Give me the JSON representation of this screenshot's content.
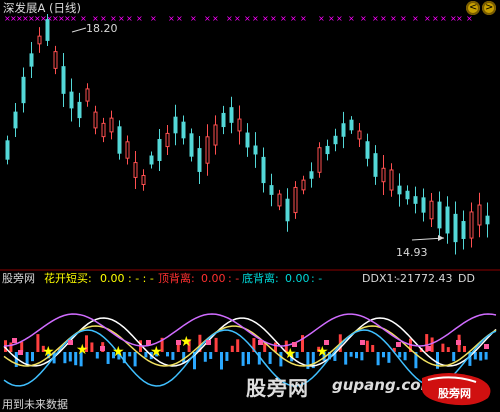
{
  "window": {
    "title": "深发展A (日线)",
    "nav_left": "<",
    "nav_right": ">"
  },
  "price_panel": {
    "high_label": "18.20",
    "low_label": "14.93"
  },
  "indicator_bar": {
    "name": "股旁网",
    "item1_label": "花开短买:",
    "item1_value": "0.00",
    "item1_extra": ": - : -",
    "item2_label": "顶背离:",
    "item2_value": "0.00",
    "item2_extra": ": -",
    "item3_label": "底背离:",
    "item3_value": "0.00",
    "item3_extra": ": -",
    "ddx_label": "DDX1:",
    "ddx_value": "-21772.43",
    "ddx_extra": "DD"
  },
  "footer": {
    "function_text": "用到未来数据"
  },
  "watermark": {
    "site_cn": "股旁网",
    "site_en": "gupang.com",
    "logo_text": "股旁网"
  },
  "colors": {
    "background": "#000000",
    "up_candle": "#ff5050",
    "down_candle": "#54d8d8",
    "marker_magenta": "#ff00ff",
    "label_yellow": "#ffff00",
    "label_red": "#ff3030",
    "label_cyan": "#00d8d8",
    "label_white": "#d8d8d8"
  }
}
